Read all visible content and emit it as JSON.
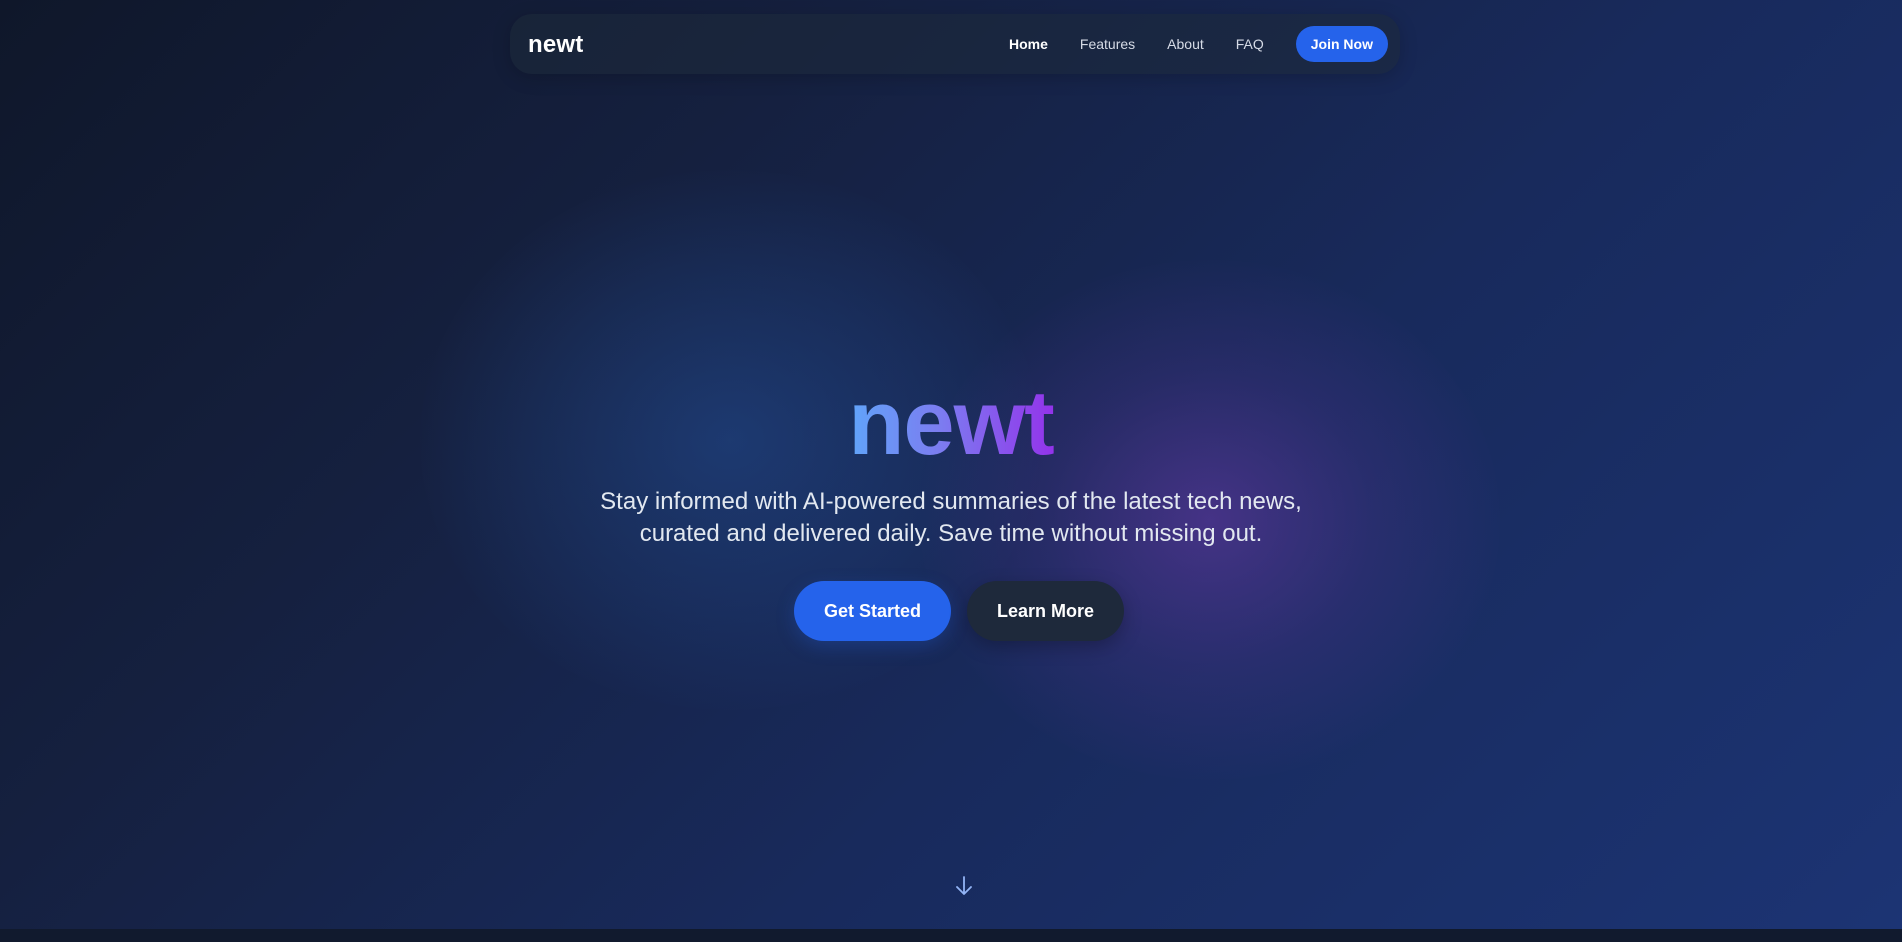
{
  "nav": {
    "logo": "newt",
    "links": [
      {
        "label": "Home",
        "active": true
      },
      {
        "label": "Features",
        "active": false
      },
      {
        "label": "About",
        "active": false
      },
      {
        "label": "FAQ",
        "active": false
      }
    ],
    "cta_label": "Join Now"
  },
  "hero": {
    "title": "newt",
    "subtitle": "Stay informed with AI-powered summaries of the latest tech news, curated and delivered daily. Save time without missing out.",
    "primary_button": "Get Started",
    "secondary_button": "Learn More"
  },
  "icons": {
    "scroll_indicator": "arrow-down-icon"
  },
  "colors": {
    "accent": "#2563eb",
    "gradient_start": "#60a5fa",
    "gradient_end": "#9333ea",
    "background": "#0f172a"
  }
}
